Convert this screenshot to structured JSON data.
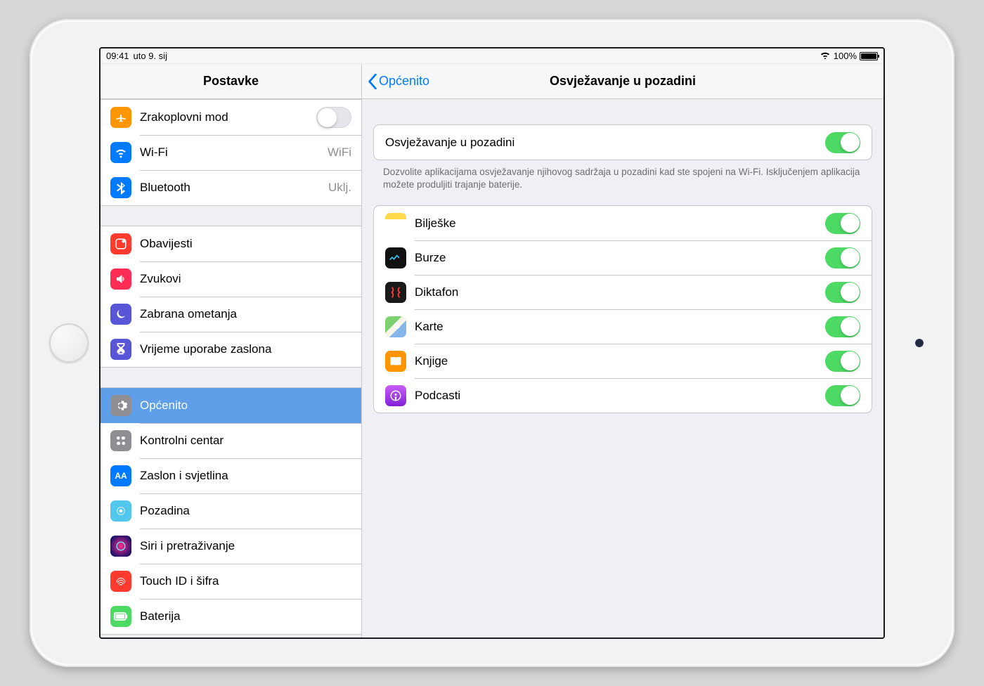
{
  "status": {
    "time": "09:41",
    "date": "uto 9. sij",
    "battery_pct": "100%"
  },
  "sidebar": {
    "title": "Postavke",
    "group1": [
      {
        "id": "airplane",
        "label": "Zrakoplovni mod"
      },
      {
        "id": "wifi",
        "label": "Wi-Fi",
        "value": "WiFi"
      },
      {
        "id": "bluetooth",
        "label": "Bluetooth",
        "value": "Uklj."
      }
    ],
    "group2": [
      {
        "id": "notif",
        "label": "Obavijesti"
      },
      {
        "id": "sounds",
        "label": "Zvukovi"
      },
      {
        "id": "dnd",
        "label": "Zabrana ometanja"
      },
      {
        "id": "screentime",
        "label": "Vrijeme uporabe zaslona"
      }
    ],
    "group3": [
      {
        "id": "general",
        "label": "Općenito"
      },
      {
        "id": "cc",
        "label": "Kontrolni centar"
      },
      {
        "id": "display",
        "label": "Zaslon i svjetlina"
      },
      {
        "id": "wall",
        "label": "Pozadina"
      },
      {
        "id": "siri",
        "label": "Siri i pretraživanje"
      },
      {
        "id": "touchid",
        "label": "Touch ID i šifra"
      },
      {
        "id": "battery",
        "label": "Baterija"
      }
    ]
  },
  "detail": {
    "back_label": "Općenito",
    "title": "Osvježavanje u pozadini",
    "master": {
      "label": "Osvježavanje u pozadini",
      "on": true
    },
    "footer": "Dozvolite aplikacijama osvježavanje njihovog sadržaja u pozadini kad ste spojeni na Wi-Fi. Isključenjem aplikacija možete produljiti trajanje baterije.",
    "apps": [
      {
        "id": "notes",
        "label": "Bilješke",
        "on": true
      },
      {
        "id": "stocks",
        "label": "Burze",
        "on": true
      },
      {
        "id": "voice",
        "label": "Diktafon",
        "on": true
      },
      {
        "id": "maps",
        "label": "Karte",
        "on": true
      },
      {
        "id": "books",
        "label": "Knjige",
        "on": true
      },
      {
        "id": "podcasts",
        "label": "Podcasti",
        "on": true
      }
    ]
  }
}
